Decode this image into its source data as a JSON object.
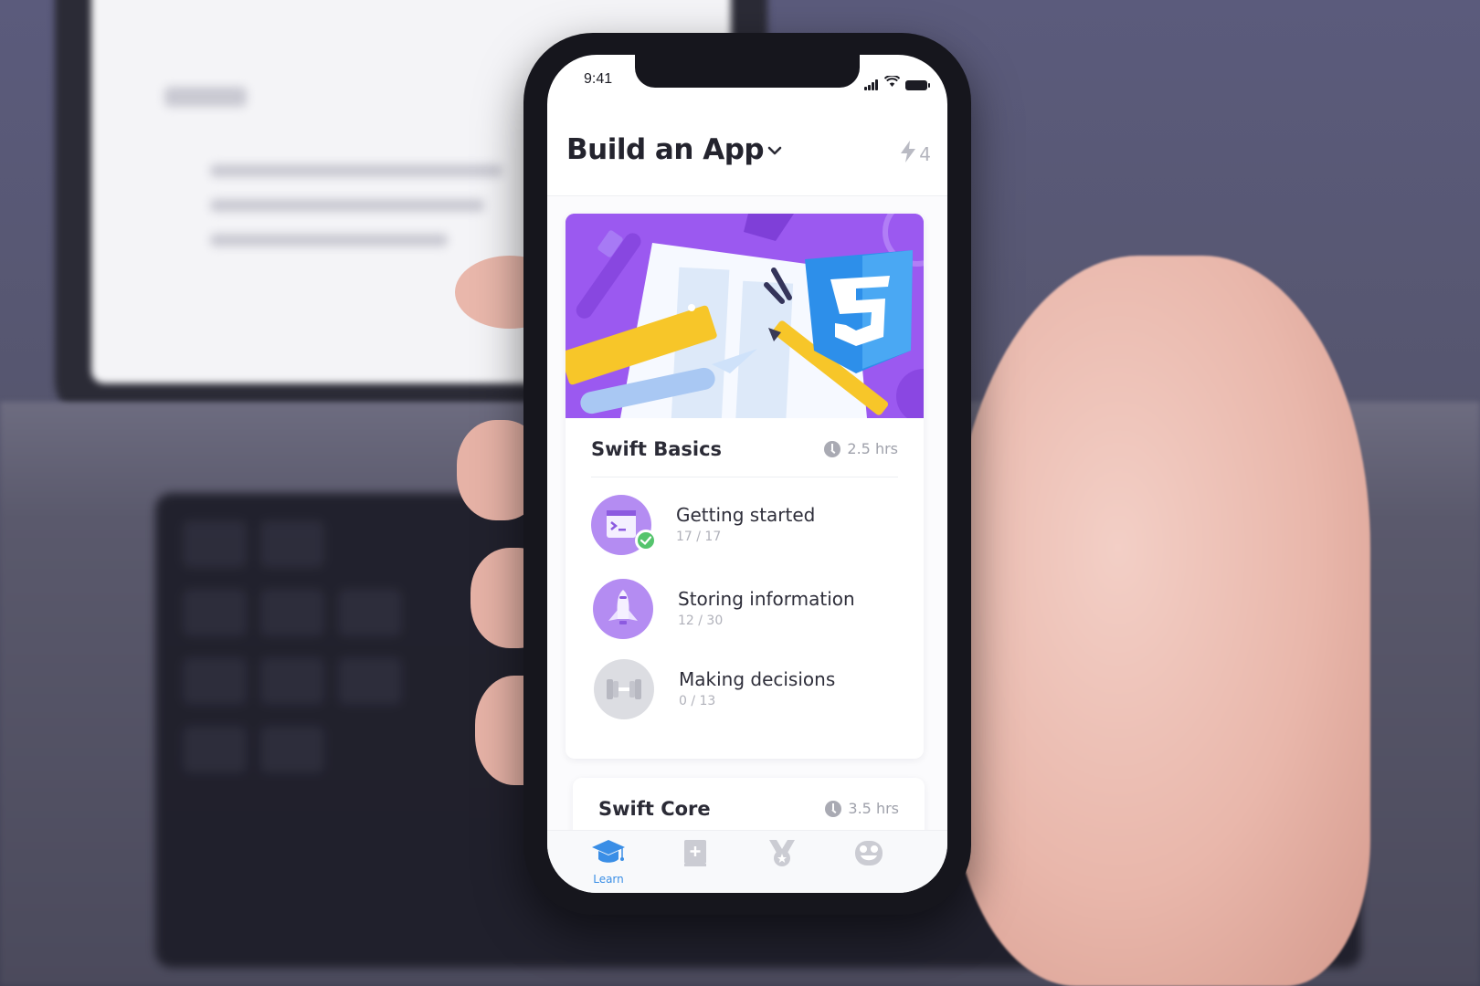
{
  "status_bar": {
    "time": "9:41",
    "icons": [
      "cellular-signal-icon",
      "wifi-icon",
      "battery-icon"
    ]
  },
  "header": {
    "title": "Build an App",
    "dropdown_icon": "chevron-down-icon",
    "streak_icon": "lightning-bolt-icon",
    "streak_count": "4"
  },
  "courses": [
    {
      "title": "Swift Basics",
      "duration": "2.5 hrs",
      "duration_icon": "clock-icon",
      "banner": "css3-illustration",
      "lessons": [
        {
          "name": "Getting started",
          "progress": "17 / 17",
          "completed_count": 17,
          "total_count": 17,
          "icon": "terminal-window-icon",
          "status": "completed"
        },
        {
          "name": "Storing information",
          "progress": "12 / 30",
          "completed_count": 12,
          "total_count": 30,
          "icon": "rocket-icon",
          "status": "in-progress"
        },
        {
          "name": "Making decisions",
          "progress": "0 / 13",
          "completed_count": 0,
          "total_count": 13,
          "icon": "dumbbell-icon",
          "status": "locked"
        }
      ]
    },
    {
      "title": "Swift Core",
      "duration": "3.5 hrs",
      "duration_icon": "clock-icon"
    }
  ],
  "tab_bar": {
    "active": "learn",
    "tabs": [
      {
        "id": "learn",
        "label": "Learn",
        "icon": "graduation-cap-icon"
      },
      {
        "id": "notebook",
        "label": "",
        "icon": "notebook-plus-icon"
      },
      {
        "id": "achievements",
        "label": "",
        "icon": "medal-icon"
      },
      {
        "id": "profile",
        "label": "",
        "icon": "robot-face-icon"
      }
    ]
  },
  "colors": {
    "accent_purple": "#9b59f0",
    "lesson_purple": "#b48cf2",
    "tab_active_blue": "#3a8ee6",
    "success_green": "#55c46d",
    "locked_gray": "#d9dae0",
    "css3_blue": "#2d8fea",
    "ruler_yellow": "#f7c629"
  }
}
